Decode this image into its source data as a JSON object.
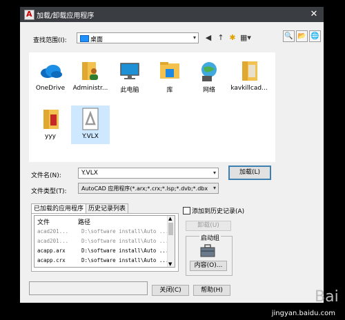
{
  "window": {
    "title": "加载/卸载应用程序",
    "close_glyph": "✕"
  },
  "lookin": {
    "label": "查找范围(I):",
    "value": "桌面",
    "arrow": "▾"
  },
  "toolbar": {
    "back": "◀",
    "up": "↑",
    "newfolder": "✱",
    "views": "▦▾",
    "btn1": "🔍",
    "btn2": "📂",
    "btn3": "🌐"
  },
  "files": [
    {
      "name": "OneDrive",
      "icon": "cloud-icon"
    },
    {
      "name": "Administr...",
      "icon": "user-folder-icon"
    },
    {
      "name": "此电脑",
      "icon": "computer-icon"
    },
    {
      "name": "库",
      "icon": "library-folder-icon"
    },
    {
      "name": "网络",
      "icon": "network-icon"
    },
    {
      "name": "kavkillcad...",
      "icon": "folder-icon"
    },
    {
      "name": "yyy",
      "icon": "folder-icon"
    },
    {
      "name": "Y.VLX",
      "icon": "vlx-file-icon"
    }
  ],
  "filename": {
    "label": "文件名(N):",
    "value": "Y.VLX",
    "arrow": "▾"
  },
  "filetype": {
    "label": "文件类型(T):",
    "value": "AutoCAD 应用程序(*.arx;*.crx;*.lsp;*.dvb;*.dbx",
    "arrow": "▾"
  },
  "load_button": "加载(L)",
  "tabs": {
    "loaded": "已加载的应用程序",
    "history": "历史记录列表"
  },
  "history_checkbox": "添加到历史记录(A)",
  "applist": {
    "columns": [
      "文件",
      "路径"
    ],
    "rows": [
      {
        "file": "acad201...",
        "path": "D:\\software install\\Auto ...",
        "dim": true
      },
      {
        "file": "acad201...",
        "path": "D:\\software install\\Auto ...",
        "dim": true
      },
      {
        "file": "acapp.arx",
        "path": "D:\\software install\\Auto ...",
        "dim": false
      },
      {
        "file": "acapp.crx",
        "path": "D:\\software install\\Auto ...",
        "dim": false
      }
    ],
    "scroll_up": "▲",
    "scroll_down": "▼"
  },
  "unload_button": "卸载(U)",
  "startup": {
    "title": "启动组",
    "contents_button": "内容(O)..."
  },
  "close_button": "关闭(C)",
  "help_button": "帮助(H)",
  "watermark": "jingyan.baidu.com",
  "watermark_logo": "Bai"
}
